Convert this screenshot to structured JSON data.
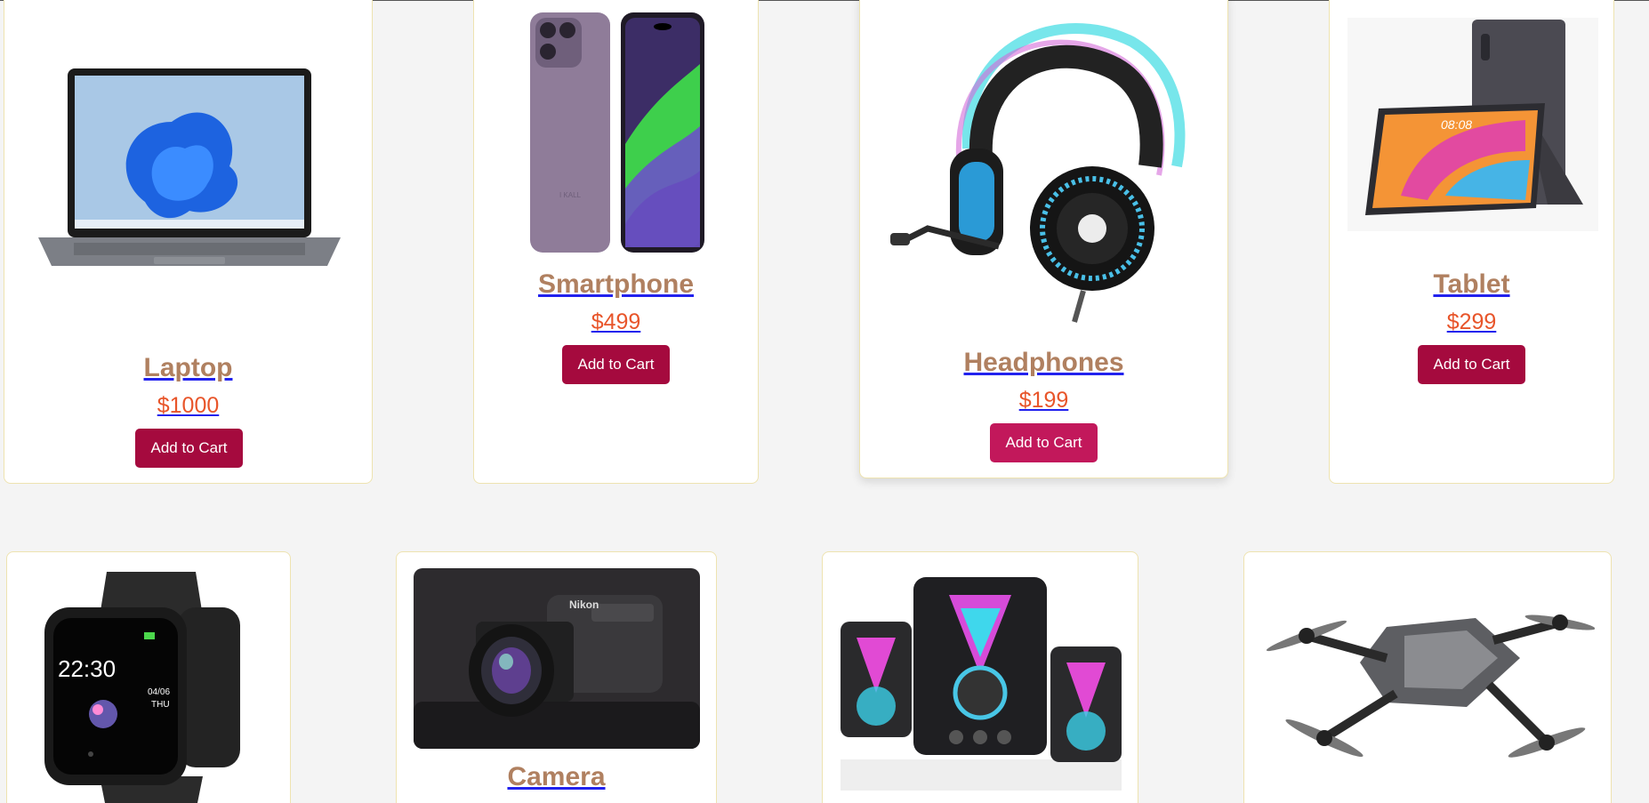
{
  "products": [
    {
      "name": "Laptop",
      "price": "$1000",
      "cta": "Add to Cart",
      "icon": "laptop-image"
    },
    {
      "name": "Smartphone",
      "price": "$499",
      "cta": "Add to Cart",
      "icon": "smartphone-image"
    },
    {
      "name": "Headphones",
      "price": "$199",
      "cta": "Add to Cart",
      "icon": "headphones-image"
    },
    {
      "name": "Tablet",
      "price": "$299",
      "cta": "Add to Cart",
      "icon": "tablet-image"
    },
    {
      "name": "",
      "icon": "smartwatch-image",
      "watch_time": "22:30",
      "watch_date": "04/06",
      "watch_day": "THU"
    },
    {
      "name": "Camera",
      "icon": "camera-image",
      "camera_brand": "Nikon"
    },
    {
      "name": "",
      "icon": "speakers-image"
    },
    {
      "name": "",
      "icon": "drone-image"
    }
  ],
  "colors": {
    "page_bg": "#f4f4f4",
    "card_border": "#eee3b0",
    "title": "#b08060",
    "price": "#e8552a",
    "button": "#a50a3e",
    "button_hover": "#c2185b"
  }
}
